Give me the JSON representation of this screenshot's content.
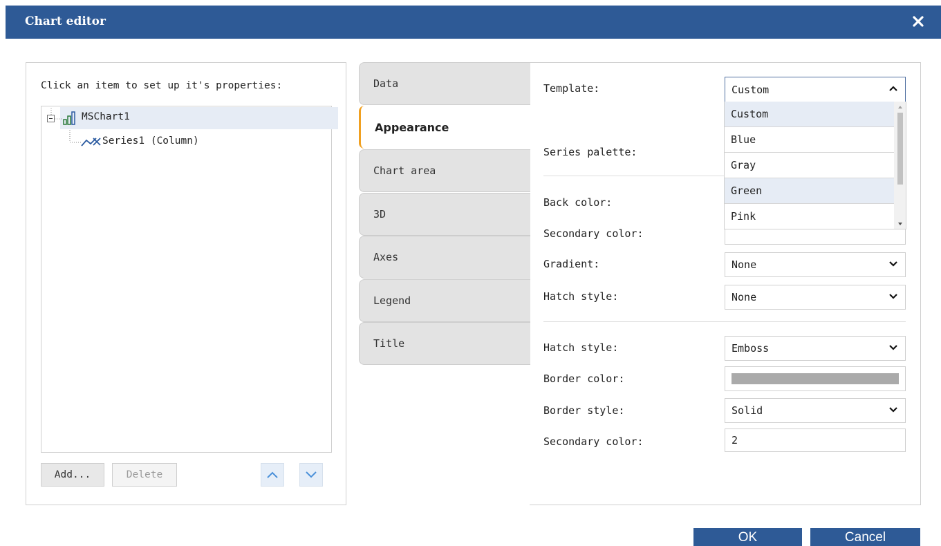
{
  "dialog": {
    "title": "Chart editor"
  },
  "tree": {
    "hint": "Click an item to set up it's properties:",
    "root_label": "MSChart1",
    "child_label": "Series1 (Column)"
  },
  "tree_buttons": {
    "add": "Add...",
    "delete": "Delete"
  },
  "tabs": [
    "Data",
    "Appearance",
    "Chart area",
    "3D",
    "Axes",
    "Legend",
    "Title"
  ],
  "active_tab": "Appearance",
  "properties": {
    "template_label": "Template:",
    "template_value": "Custom",
    "series_palette_label": "Series palette:",
    "back_color_label": "Back color:",
    "secondary_color_label": "Secondary color:",
    "gradient_label": "Gradient:",
    "gradient_value": "None",
    "hatch_style_label": "Hatch style:",
    "hatch_style_value": "None",
    "hatch_style2_label": "Hatch style:",
    "hatch_style2_value": "Emboss",
    "border_color_label": "Border color:",
    "border_color_value": "#aaaaaa",
    "border_style_label": "Border style:",
    "border_style_value": "Solid",
    "secondary_color2_label": "Secondary color:",
    "secondary_color2_value": "2"
  },
  "template_options": [
    "Custom",
    "Blue",
    "Gray",
    "Green",
    "Pink"
  ],
  "footer": {
    "ok": "OK",
    "cancel": "Cancel"
  },
  "colors": {
    "title_bar": "#2e5a96",
    "active_tab_accent": "#f0a020",
    "selection": "#e6ecf5"
  }
}
